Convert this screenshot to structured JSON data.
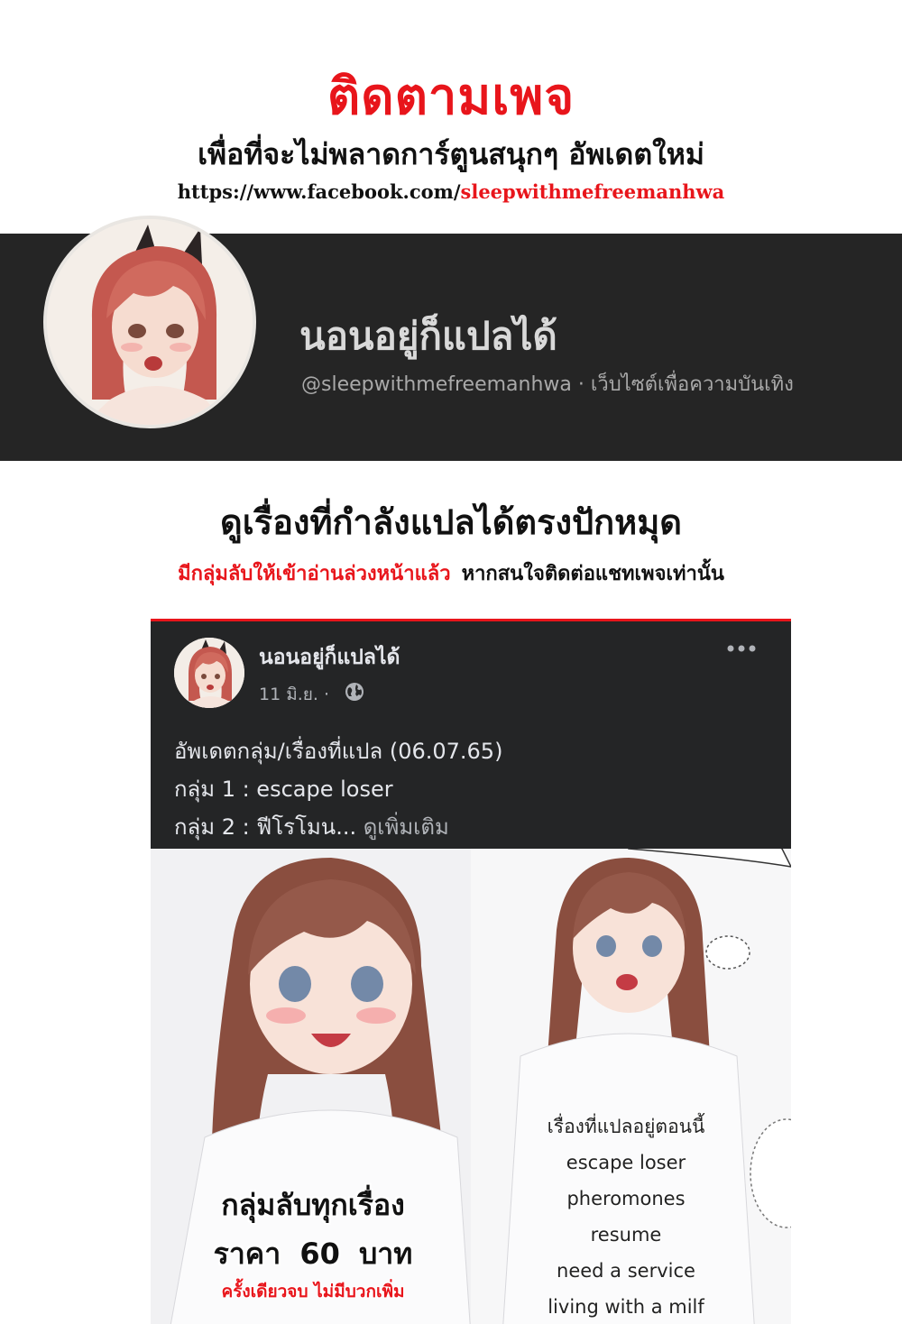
{
  "header": {
    "title": "ติดตามเพจ",
    "subtitle": "เพื่อที่จะไม่พลาดการ์ตูนสนุกๆ อัพเดตใหม่",
    "url_prefix": "https://www.facebook.com/",
    "url_path": "sleepwithmefreemanhwa"
  },
  "profile": {
    "name": "นอนอยู่ก็แปลได้",
    "meta": "@sleepwithmefreemanhwa · เว็บไซต์เพื่อความบันเทิง",
    "avatar_icon": "anime-girl-cat-ears-avatar"
  },
  "headline": "ดูเรื่องที่กำลังแปลได้ตรงปักหมุด",
  "secret_group": {
    "red_text": "มีกลุ่มลับให้เข้าอ่านล่วงหน้าแล้ว",
    "black_text": "หากสนใจติดต่อแชทเพจเท่านั้น"
  },
  "post": {
    "author": "นอนอยู่ก็แปลได้",
    "date": "11 มิ.ย. ·",
    "lines": [
      "อัพเดตกลุ่ม/เรื่องที่แปล (06.07.65)",
      "กลุ่ม 1 : escape loser",
      "กลุ่ม 2 : ฟีโรโมน..."
    ],
    "see_more": "ดูเพิ่มเติม",
    "image": {
      "promo_title": "กลุ่มลับทุกเรื่อง",
      "promo_price": "ราคา 60 บาท",
      "promo_note": "ครั้งเดียวจบ ไม่มีบวกเพิ่ม",
      "current_heading": "เรื่องที่แปลอยู่ตอนนี้",
      "current_titles": [
        "escape loser",
        "pheromones",
        "resume",
        "need a service",
        "living with a milf"
      ]
    }
  },
  "colors": {
    "accent_red": "#e8151b",
    "banner_bg": "#252525",
    "card_bg": "#242526"
  }
}
